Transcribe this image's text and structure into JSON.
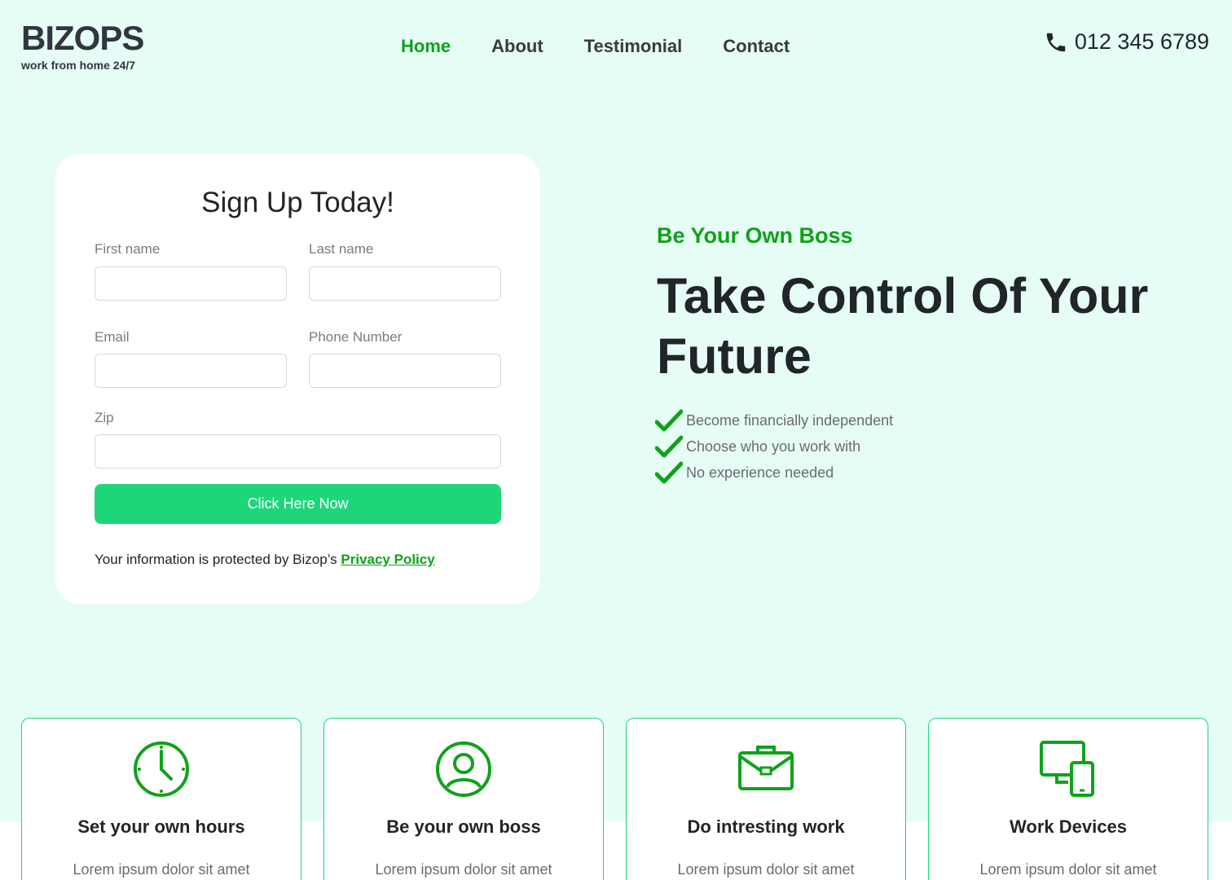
{
  "brand": {
    "name": "BIZOPS",
    "tagline": "work from home 24/7"
  },
  "nav": {
    "items": [
      "Home",
      "About",
      "Testimonial",
      "Contact"
    ],
    "active": "Home"
  },
  "header": {
    "phone": "012 345 6789",
    "phone_icon": "phone-icon"
  },
  "signup": {
    "title": "Sign Up Today!",
    "first_name_label": "First name",
    "first_name_value": "",
    "last_name_label": "Last name",
    "last_name_value": "",
    "email_label": "Email",
    "email_value": "",
    "phone_label": "Phone Number",
    "phone_value": "",
    "zip_label": "Zip",
    "zip_value": "",
    "submit_label": "Click Here Now",
    "privacy_text": "Your information is protected by Bizop’s ",
    "privacy_link": "Privacy Policy"
  },
  "hero": {
    "eyebrow": "Be Your Own Boss",
    "headline": "Take Control Of Your Future",
    "bullets": [
      "Become financially independent",
      "Choose who you work with",
      "No experience needed"
    ]
  },
  "features": [
    {
      "icon": "clock-icon",
      "title": "Set your own hours",
      "text": "Lorem ipsum dolor sit amet"
    },
    {
      "icon": "user-icon",
      "title": "Be your own boss",
      "text": "Lorem ipsum dolor sit amet"
    },
    {
      "icon": "briefcase-icon",
      "title": "Do intresting work",
      "text": "Lorem ipsum dolor sit amet"
    },
    {
      "icon": "devices-icon",
      "title": "Work Devices",
      "text": "Lorem ipsum dolor sit amet"
    }
  ],
  "colors": {
    "background": "#e6fdf5",
    "accent_green": "#0fa21a",
    "button_green": "#1dd67a",
    "text_dark": "#212529"
  }
}
